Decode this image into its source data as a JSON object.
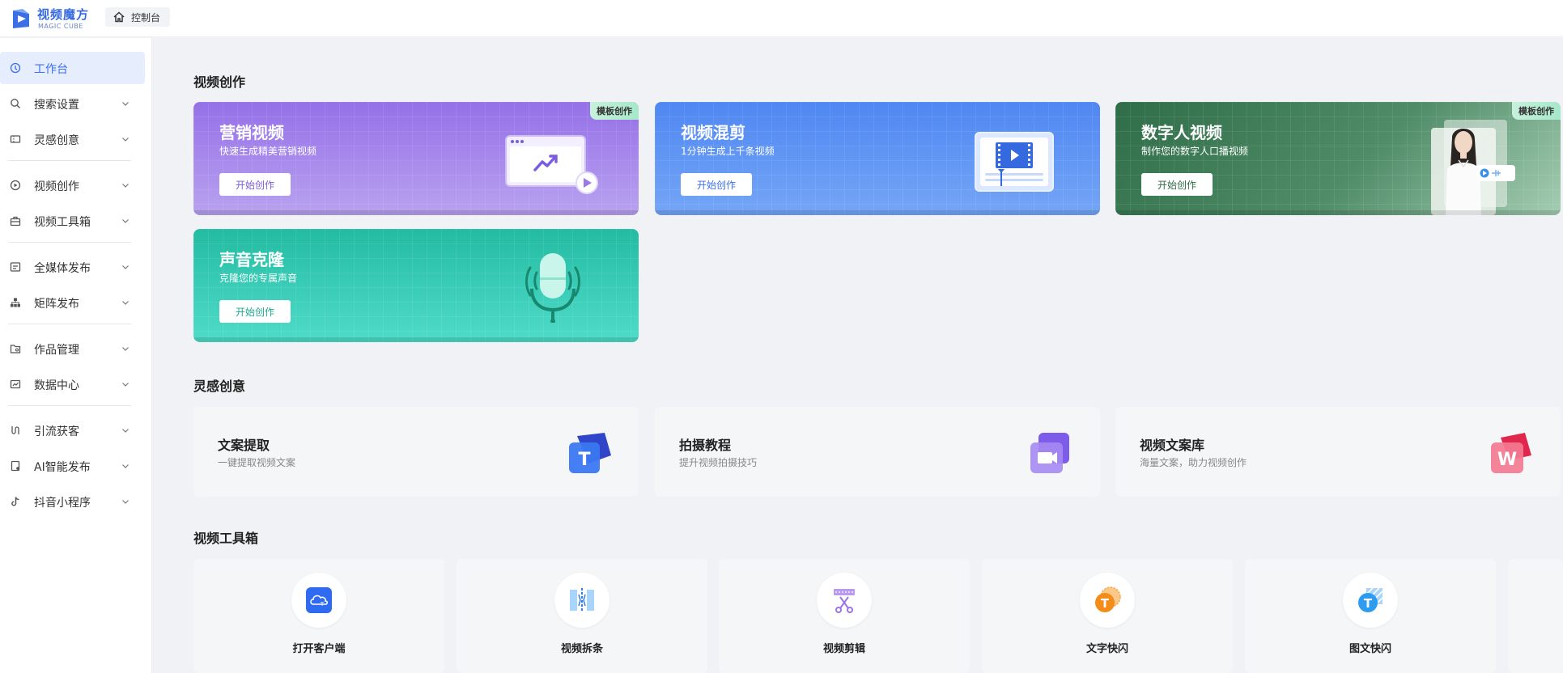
{
  "app": {
    "logo_cn": "视频魔方",
    "logo_en": "MAGIC CUBE",
    "breadcrumb": "控制台"
  },
  "colors": {
    "accent": "#3a6ff0",
    "sidebar_active_bg": "#e6edfc",
    "marketing": "#9b74e6",
    "mix": "#5b8ef3",
    "digital_human": "#3d7a55",
    "voice": "#2fc3a8"
  },
  "sidebar": {
    "items": [
      {
        "label": "工作台",
        "icon": "dashboard-icon",
        "active": true
      },
      {
        "label": "搜索设置",
        "icon": "search-icon"
      },
      {
        "label": "灵感创意",
        "icon": "ticket-icon"
      },
      {
        "label": "视频创作",
        "icon": "play-circle-icon"
      },
      {
        "label": "视频工具箱",
        "icon": "toolbox-icon"
      },
      {
        "label": "全媒体发布",
        "icon": "publish-icon"
      },
      {
        "label": "矩阵发布",
        "icon": "matrix-icon"
      },
      {
        "label": "作品管理",
        "icon": "folder-icon"
      },
      {
        "label": "数据中心",
        "icon": "data-icon"
      },
      {
        "label": "引流获客",
        "icon": "funnel-icon"
      },
      {
        "label": "AI智能发布",
        "icon": "ai-publish-icon"
      },
      {
        "label": "抖音小程序",
        "icon": "tiktok-icon"
      }
    ]
  },
  "sections": {
    "creation": "视频创作",
    "inspiration": "灵感创意",
    "toolbox": "视频工具箱"
  },
  "creation_cards": [
    {
      "title": "营销视频",
      "subtitle": "快速生成精美营销视频",
      "button": "开始创作",
      "tag": "模板创作",
      "icon": "trend-chart-icon"
    },
    {
      "title": "视频混剪",
      "subtitle": "1分钟生成上千条视频",
      "button": "开始创作",
      "tag": "",
      "icon": "video-editor-icon"
    },
    {
      "title": "数字人视频",
      "subtitle": "制作您的数字人口播视频",
      "button": "开始创作",
      "tag": "模板创作",
      "icon": "avatar-presenter-icon"
    },
    {
      "title": "声音克隆",
      "subtitle": "克隆您的专属声音",
      "button": "开始创作",
      "tag": "",
      "icon": "microphone-icon"
    }
  ],
  "inspiration_cards": [
    {
      "title": "文案提取",
      "subtitle": "一键提取视频文案",
      "icon": "text-extract-icon"
    },
    {
      "title": "拍摄教程",
      "subtitle": "提升视频拍摄技巧",
      "icon": "camera-icon"
    },
    {
      "title": "视频文案库",
      "subtitle": "海量文案，助力视频创作",
      "icon": "word-library-icon"
    }
  ],
  "tools": [
    {
      "label": "打开客户端",
      "icon": "cloud-client-icon"
    },
    {
      "label": "视频拆条",
      "icon": "video-split-icon"
    },
    {
      "label": "视频剪辑",
      "icon": "scissors-icon"
    },
    {
      "label": "文字快闪",
      "icon": "text-flash-icon"
    },
    {
      "label": "图文快闪",
      "icon": "image-text-flash-icon"
    }
  ]
}
